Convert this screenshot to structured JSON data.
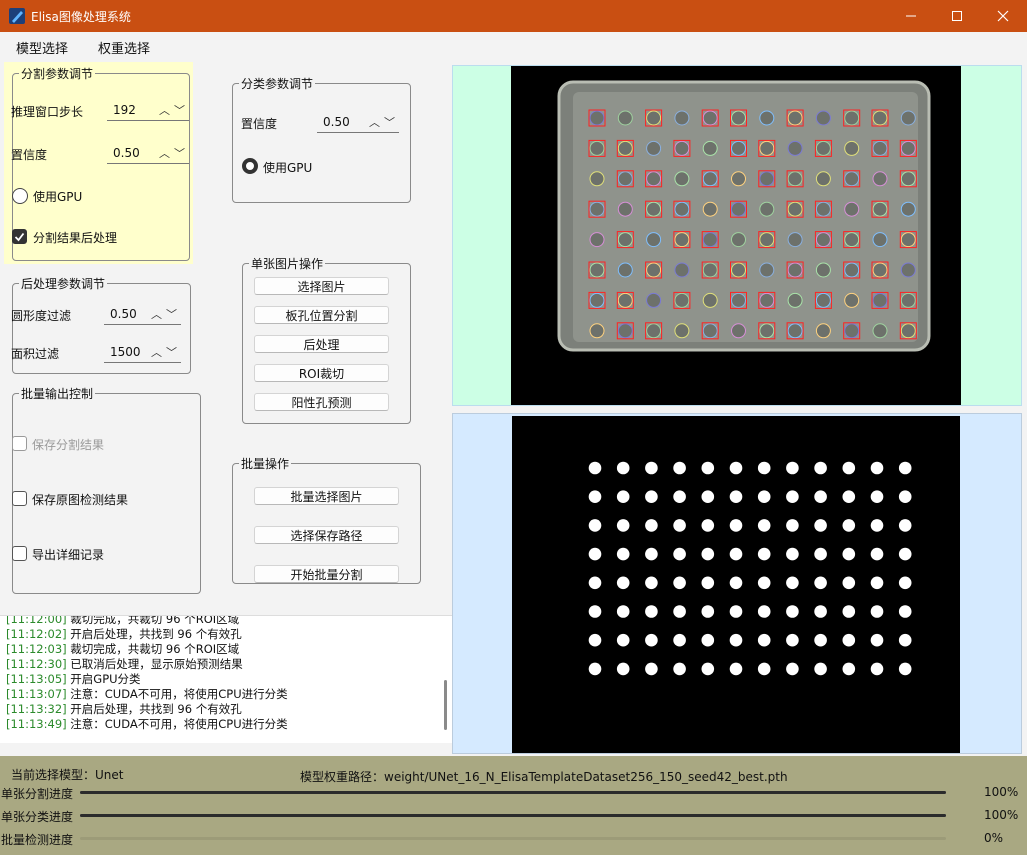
{
  "window": {
    "title": "Elisa图像处理系统",
    "controls": [
      "minimize-icon",
      "maximize-icon",
      "close-icon"
    ]
  },
  "menu": [
    "模型选择",
    "权重选择"
  ],
  "seg_params": {
    "title": "分割参数调节",
    "stride_label": "推理窗口步长",
    "stride_value": "192",
    "conf_label": "置信度",
    "conf_value": "0.50",
    "gpu_label": "使用GPU",
    "gpu_checked": false,
    "post_label": "分割结果后处理",
    "post_checked": true
  },
  "cls_params": {
    "title": "分类参数调节",
    "conf_label": "置信度",
    "conf_value": "0.50",
    "gpu_label": "使用GPU",
    "gpu_checked": true
  },
  "post_params": {
    "title": "后处理参数调节",
    "circ_label": "圆形度过滤",
    "circ_value": "0.50",
    "area_label": "面积过滤",
    "area_value": "1500"
  },
  "single_ops": {
    "title": "单张图片操作",
    "buttons": [
      "选择图片",
      "板孔位置分割",
      "后处理",
      "ROI裁切",
      "阳性孔预测"
    ]
  },
  "batch_output": {
    "title": "批量输出控制",
    "save_seg": "保存分割结果",
    "save_orig": "保存原图检测结果",
    "export_log": "导出详细记录"
  },
  "batch_ops": {
    "title": "批量操作",
    "buttons": [
      "批量选择图片",
      "选择保存路径",
      "开始批量分割"
    ]
  },
  "log": [
    {
      "ts": "[11:12:00]",
      "msg": "裁切完成，共裁切 96 个ROI区域"
    },
    {
      "ts": "[11:12:02]",
      "msg": "开启后处理，共找到 96 个有效孔"
    },
    {
      "ts": "[11:12:03]",
      "msg": "裁切完成，共裁切 96 个ROI区域"
    },
    {
      "ts": "[11:12:30]",
      "msg": "已取消后处理，显示原始预测结果"
    },
    {
      "ts": "[11:13:05]",
      "msg": "开启GPU分类"
    },
    {
      "ts": "[11:13:07]",
      "msg": "注意：CUDA不可用，将使用CPU进行分类"
    },
    {
      "ts": "[11:13:32]",
      "msg": "开启后处理，共找到 96 个有效孔"
    },
    {
      "ts": "[11:13:49]",
      "msg": "注意：CUDA不可用，将使用CPU进行分类"
    }
  ],
  "status": {
    "model_label": "当前选择模型：Unet",
    "weight_label": "模型权重路径：weight/UNet_16_N_ElisaTemplateDataset256_150_seed42_best.pth",
    "progress": [
      {
        "label": "单张分割进度",
        "value": "100%",
        "fraction": 1.0
      },
      {
        "label": "单张分类进度",
        "value": "100%",
        "fraction": 1.0
      },
      {
        "label": "批量检测进度",
        "value": "0%",
        "fraction": 0.0
      }
    ]
  },
  "plate": {
    "rows": 8,
    "cols": 12
  },
  "colors": {
    "titlebar": "#c94f12",
    "seg_panel_bg": "#ffffcc",
    "top_view_bg": "#ccffe5",
    "bottom_view_bg": "#d5eaff",
    "status_bg": "#a9a882",
    "positive_box": "#ff2222"
  }
}
